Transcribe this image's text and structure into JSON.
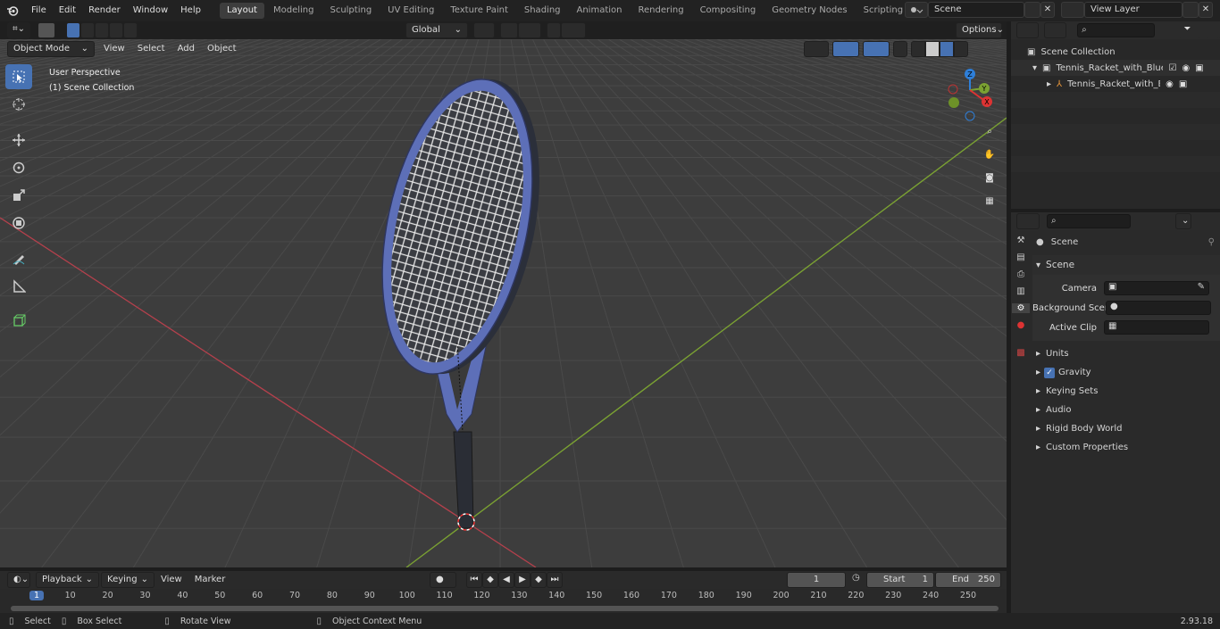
{
  "menubar": {
    "items": [
      "File",
      "Edit",
      "Render",
      "Window",
      "Help"
    ],
    "workspaces": [
      "Layout",
      "Modeling",
      "Sculpting",
      "UV Editing",
      "Texture Paint",
      "Shading",
      "Animation",
      "Rendering",
      "Compositing",
      "Geometry Nodes",
      "Scripting"
    ],
    "active_workspace": "Layout",
    "add_tab": "+",
    "scene": "Scene",
    "view_layer": "View Layer"
  },
  "viewport_header": {
    "transform_orientation": "Global",
    "options": "Options",
    "mode": "Object Mode",
    "menus": [
      "View",
      "Select",
      "Add",
      "Object"
    ]
  },
  "viewport": {
    "perspective": "User Perspective",
    "collection": "(1) Scene Collection",
    "gizmo": {
      "z": "Z",
      "y": "Y",
      "x": "X"
    }
  },
  "outliner": {
    "search_placeholder": "",
    "root": "Scene Collection",
    "items": [
      "Tennis_Racket_with_Blue_Fra",
      "Tennis_Racket_with_Blue"
    ]
  },
  "properties": {
    "context": "Scene",
    "panel": "Scene",
    "fields": [
      "Camera",
      "Background Scene",
      "Active Clip"
    ],
    "subpanels": [
      "Units",
      "Gravity",
      "Keying Sets",
      "Audio",
      "Rigid Body World",
      "Custom Properties"
    ],
    "gravity_checked": true
  },
  "timeline": {
    "menus": [
      "Playback",
      "Keying",
      "View",
      "Marker"
    ],
    "current_frame": "1",
    "start_label": "Start",
    "start": "1",
    "end_label": "End",
    "end": "250",
    "ticks": [
      "1",
      "10",
      "20",
      "30",
      "40",
      "50",
      "60",
      "70",
      "80",
      "90",
      "100",
      "110",
      "120",
      "130",
      "140",
      "150",
      "160",
      "170",
      "180",
      "190",
      "200",
      "210",
      "220",
      "230",
      "240",
      "250"
    ]
  },
  "statusbar": {
    "items": [
      "Select",
      "Box Select",
      "Rotate View",
      "Object Context Menu"
    ],
    "version": "2.93.18"
  },
  "colors": {
    "accent": "#4772b3",
    "x_axis": "#b5404c",
    "y_axis": "#7ba232",
    "racket_frame": "#5d6fb8"
  }
}
